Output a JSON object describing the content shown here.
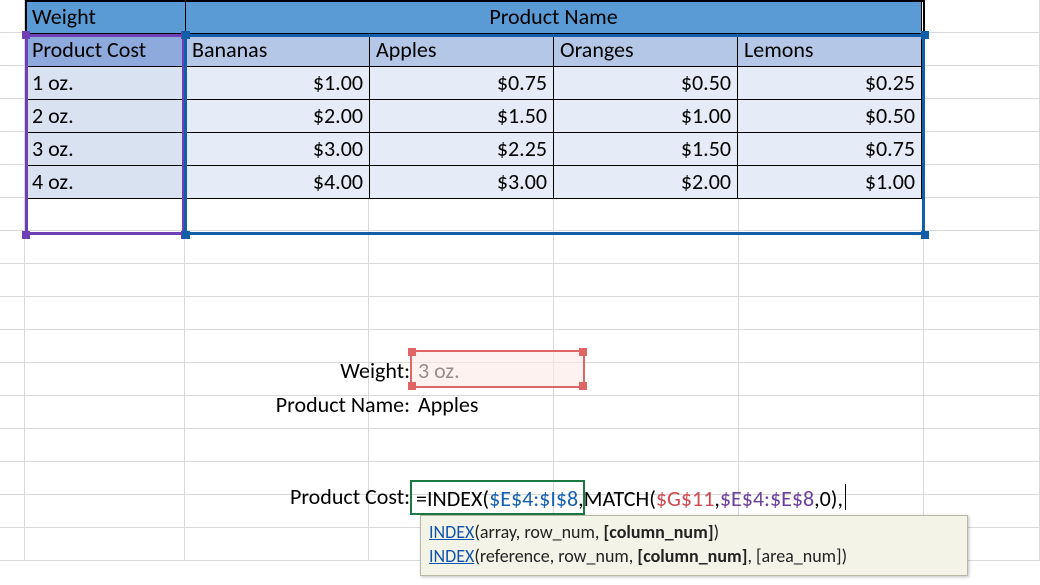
{
  "header": {
    "weight_label": "Weight",
    "product_name_label": "Product Name",
    "product_cost_label": "Product Cost"
  },
  "columns": [
    "Bananas",
    "Apples",
    "Oranges",
    "Lemons"
  ],
  "rows": [
    {
      "label": "1 oz.",
      "values": [
        "$1.00",
        "$0.75",
        "$0.50",
        "$0.25"
      ]
    },
    {
      "label": "2 oz.",
      "values": [
        "$2.00",
        "$1.50",
        "$1.00",
        "$0.50"
      ]
    },
    {
      "label": "3 oz.",
      "values": [
        "$3.00",
        "$2.25",
        "$1.50",
        "$0.75"
      ]
    },
    {
      "label": "4 oz.",
      "values": [
        "$4.00",
        "$3.00",
        "$2.00",
        "$1.00"
      ]
    }
  ],
  "lookup": {
    "weight_label": "Weight:",
    "weight_value": "3 oz.",
    "product_label": "Product Name:",
    "product_value": "Apples",
    "cost_label": "Product Cost:"
  },
  "formula": {
    "eq": "=",
    "fn_index": "INDEX",
    "open1": "(",
    "arg1": "$E$4:$I$8",
    "comma1": ",",
    "fn_match": "MATCH",
    "open2": "(",
    "arg2": "$G$11",
    "comma2": ",",
    "arg3": "$E$4:$E$8",
    "comma3": ",",
    "zero": "0",
    "close2": ")",
    "trail_comma": ","
  },
  "tooltip": {
    "line1_fn": "INDEX",
    "line1_rest": "(array, row_num, ",
    "line1_bold": "[column_num]",
    "line1_end": ")",
    "line2_fn": "INDEX",
    "line2_rest": "(reference, row_num, ",
    "line2_bold": "[column_num]",
    "line2_end": ", [area_num])"
  },
  "chart_data": {
    "type": "table",
    "title": "Product cost by weight",
    "row_labels": [
      "1 oz.",
      "2 oz.",
      "3 oz.",
      "4 oz."
    ],
    "col_labels": [
      "Bananas",
      "Apples",
      "Oranges",
      "Lemons"
    ],
    "values": [
      [
        1.0,
        0.75,
        0.5,
        0.25
      ],
      [
        2.0,
        1.5,
        1.0,
        0.5
      ],
      [
        3.0,
        2.25,
        1.5,
        0.75
      ],
      [
        4.0,
        3.0,
        2.0,
        1.0
      ]
    ],
    "currency": "USD"
  }
}
